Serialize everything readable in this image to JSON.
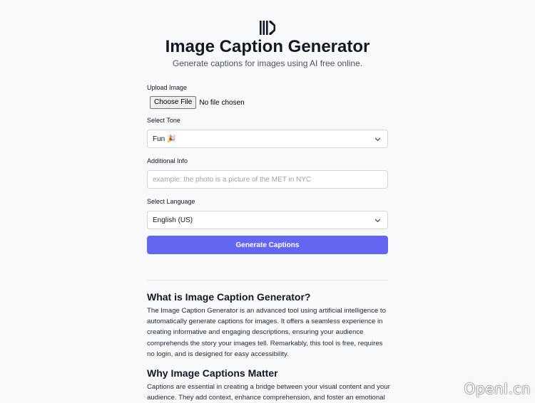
{
  "header": {
    "title": "Image Caption Generator",
    "subtitle": "Generate captions for images using AI free online."
  },
  "form": {
    "upload_label": "Upload Image",
    "file_button": "Choose File",
    "file_status": "No file chosen",
    "tone_label": "Select Tone",
    "tone_value": "Fun 🎉",
    "info_label": "Additional Info",
    "info_placeholder": "example: the photo is a picture of the MET in NYC",
    "language_label": "Select Language",
    "language_value": "English (US)",
    "submit_label": "Generate Captions"
  },
  "article": {
    "heading1": "What is Image Caption Generator?",
    "para1": "The Image Caption Generator is an advanced tool using artificial intelligence to automatically generate captions for images. It offers a seamless experience in creating informative and engaging descriptions, ensuring your audience comprehends the story your images tell. Remarkably, this tool is free, requires no login, and is designed for easy accessibility.",
    "heading2": "Why Image Captions Matter",
    "para2": "Captions are essential in creating a bridge between your visual content and your audience. They add context, enhance comprehension, and foster an emotional"
  },
  "watermark": "OpenI.cn",
  "colors": {
    "accent": "#6366f1",
    "background": "#f8f9fb"
  },
  "icons": {
    "logo": "logo-icon",
    "dropdown": "chevron-down-icon"
  }
}
